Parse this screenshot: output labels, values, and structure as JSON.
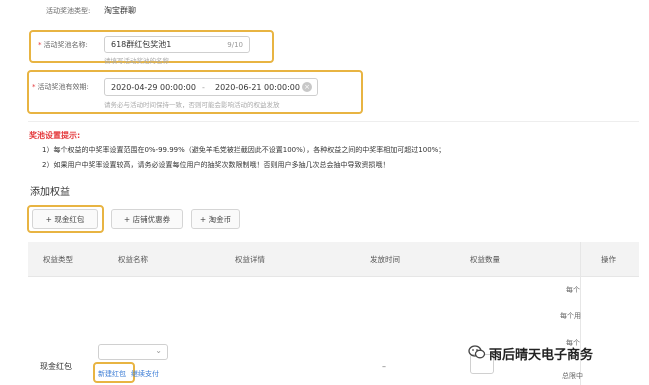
{
  "pool_type": {
    "label": "活动奖池类型:",
    "value": "淘宝群聊"
  },
  "pool_name": {
    "label": "活动奖池名称:",
    "value": "618群红包奖池1",
    "counter": "9/10",
    "hint": "请填写活动奖池的名称"
  },
  "pool_period": {
    "label": "活动奖池有效期:",
    "start": "2020-04-29 00:00:00",
    "separator": "-",
    "end": "2020-06-21 00:00:00",
    "hint": "请务必与活动时间保持一致，否则可能会影响活动的权益发放"
  },
  "settings_tip": {
    "title": "奖池设置提示:",
    "lines": [
      "1）每个权益的中奖率设置范围在0%-99.99%（避免羊毛党被拦截因此不设置100%），各种权益之间的中奖率相加可超过100%；",
      "2）如果用户中奖率设置较高，请务必设置每位用户的抽奖次数限制哦！否则用户多抽几次总会抽中导致资损哦！"
    ]
  },
  "benefits": {
    "title": "添加权益",
    "buttons": [
      "+ 现金红包",
      "+ 店铺优惠券",
      "+ 淘金币"
    ]
  },
  "table": {
    "headers": [
      "权益类型",
      "权益名称",
      "权益详情",
      "发放时间",
      "权益数量",
      "操作"
    ],
    "right_notes": [
      "每个",
      "每个用",
      "每个",
      "总限中"
    ],
    "row": {
      "type": "现金红包",
      "new_link": "新建红包",
      "continue_link": "继续支付",
      "dash": "–"
    }
  },
  "watermark": {
    "text": "雨后晴天电子商务"
  },
  "colors": {
    "highlight": "#e8b442",
    "warning": "#e4393c",
    "link": "#3a7bd5"
  }
}
